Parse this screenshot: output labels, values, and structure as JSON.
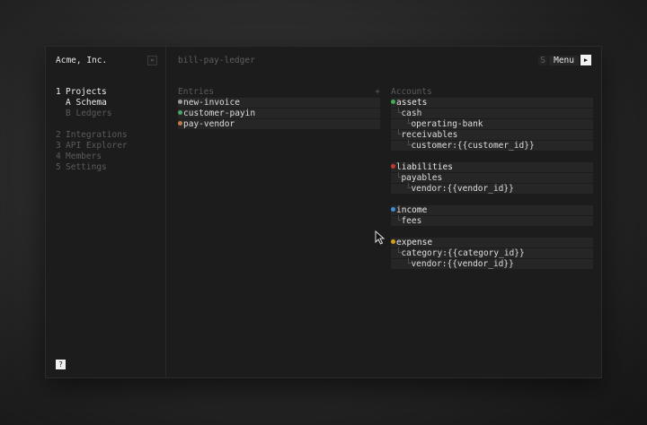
{
  "sidebar": {
    "org_name": "Acme, Inc.",
    "collapse_glyph": "«",
    "nav": [
      {
        "key": "1",
        "label": "Projects"
      },
      {
        "key": "A",
        "label": "Schema"
      },
      {
        "key": "B",
        "label": "Ledgers"
      },
      {
        "key": "2",
        "label": "Integrations"
      },
      {
        "key": "3",
        "label": "API Explorer"
      },
      {
        "key": "4",
        "label": "Members"
      },
      {
        "key": "5",
        "label": "Settings"
      }
    ],
    "help_label": "?"
  },
  "header": {
    "doc_title": "bill-pay-ledger",
    "shortcut_key": "S",
    "menu_label": "Menu",
    "run_glyph": "▶"
  },
  "entries": {
    "title": "Entries",
    "add_glyph": "+",
    "items": [
      {
        "name": "new-invoice",
        "color": "#9a9a9a"
      },
      {
        "name": "customer-payin",
        "color": "#4aa36a"
      },
      {
        "name": "pay-vendor",
        "color": "#c07a4a"
      }
    ]
  },
  "accounts": {
    "title": "Accounts",
    "groups": [
      {
        "name": "assets",
        "color": "#3fae55",
        "children": [
          {
            "label": "cash"
          },
          {
            "label": "operating-bank"
          },
          {
            "label": "receivables"
          },
          {
            "label": "customer:{{customer_id}}"
          }
        ]
      },
      {
        "name": "liabilities",
        "color": "#c0392b",
        "children": [
          {
            "label": "payables"
          },
          {
            "label": "vendor:{{vendor_id}}"
          }
        ]
      },
      {
        "name": "income",
        "color": "#3b8fd9",
        "children": [
          {
            "label": "fees"
          }
        ]
      },
      {
        "name": "expense",
        "color": "#d4a017",
        "children": [
          {
            "label": "category:{{category_id}}"
          },
          {
            "label": "vendor:{{vendor_id}}"
          }
        ]
      }
    ]
  }
}
